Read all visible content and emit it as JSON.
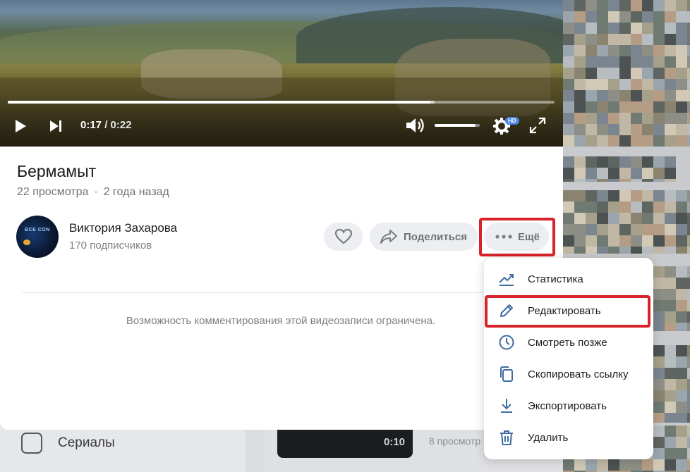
{
  "player": {
    "current_time": "0:17",
    "duration": "0:22",
    "separator": "/",
    "progress": 0.773,
    "buffered": 0.78,
    "volume": 0.9,
    "quality_badge": "HD"
  },
  "video": {
    "title": "Бермамыт",
    "views": "22 просмотра",
    "age": "2 года назад",
    "dot": "·"
  },
  "author": {
    "name": "Виктория Захарова",
    "subscribers": "170 подписчиков",
    "avatar_text": "BCE CON"
  },
  "actions": {
    "share_label": "Поделиться",
    "more_label": "Ещё"
  },
  "comments_note": "Возможность комментирования этой видеозаписи ограничена.",
  "menu": {
    "items": [
      {
        "label": "Статистика",
        "icon": "chart-trend-icon"
      },
      {
        "label": "Редактировать",
        "icon": "pencil-icon"
      },
      {
        "label": "Смотреть позже",
        "icon": "clock-icon"
      },
      {
        "label": "Скопировать ссылку",
        "icon": "copy-icon"
      },
      {
        "label": "Экспортировать",
        "icon": "download-icon"
      },
      {
        "label": "Удалить",
        "icon": "trash-icon"
      }
    ]
  },
  "background": {
    "sidebar_item": "Сериалы",
    "clip_duration": "0:10",
    "clip_views": "8 просмотр"
  },
  "colors": {
    "accent": "#2a5885",
    "icon_blue": "#3f6ca3",
    "highlight": "#d8232a",
    "button_bg": "#eceef1"
  }
}
